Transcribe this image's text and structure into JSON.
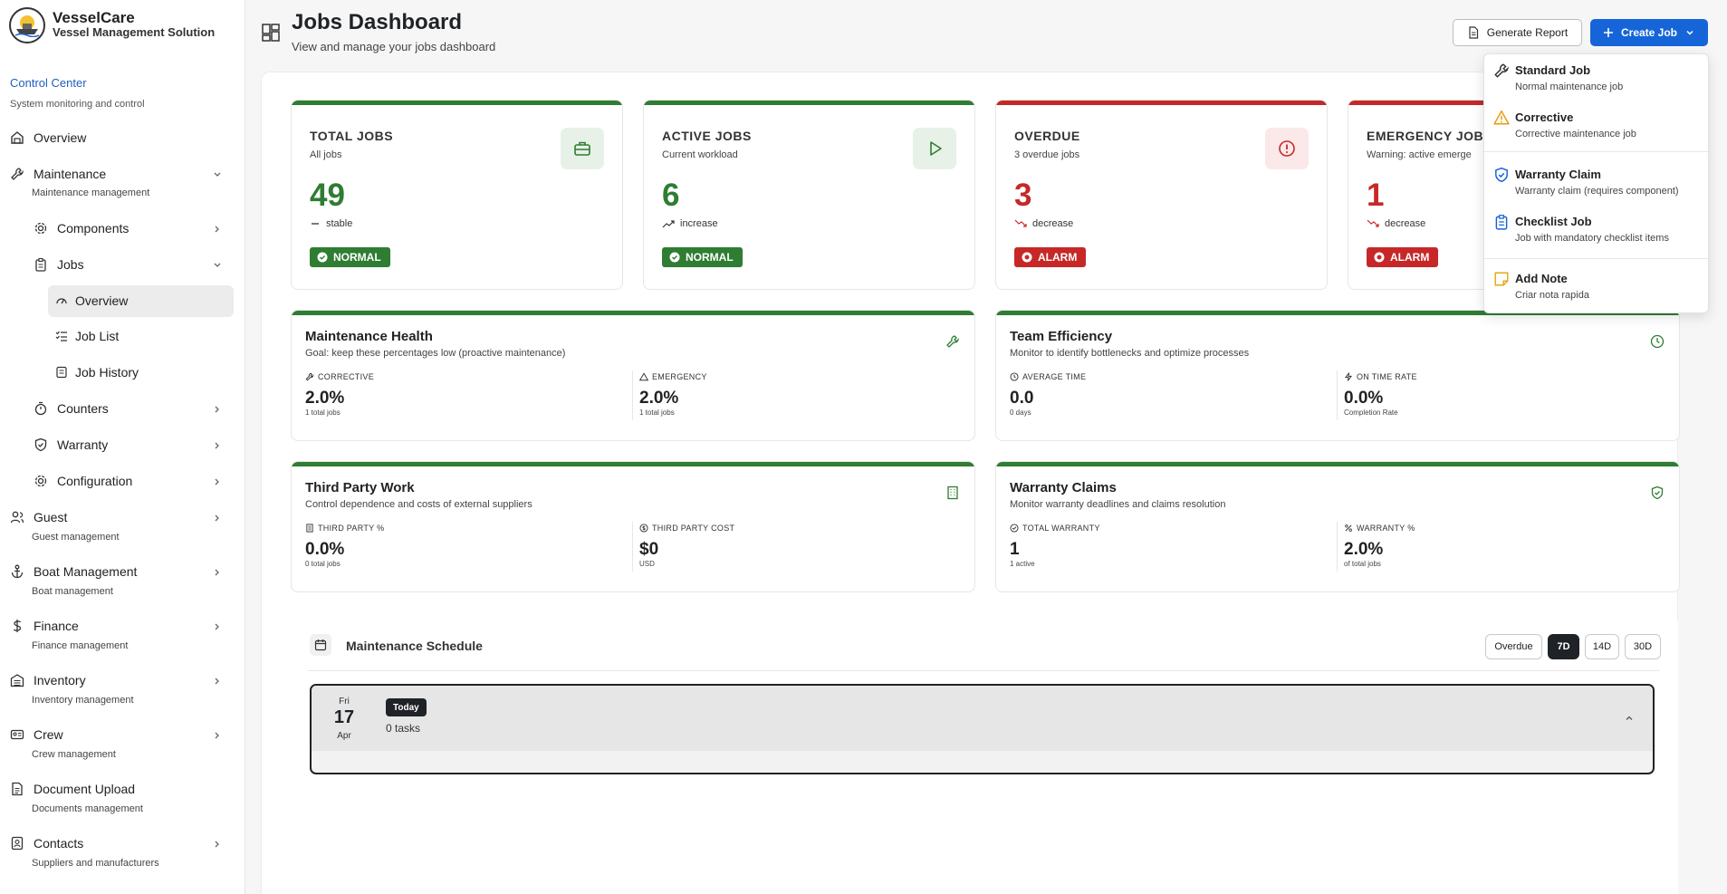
{
  "app": {
    "name": "VesselCare",
    "tagline": "Vessel Management Solution"
  },
  "sidebar": {
    "section_title": "Control Center",
    "section_sub": "System monitoring and control",
    "items": [
      {
        "label": "Overview"
      },
      {
        "label": "Maintenance",
        "sub": "Maintenance management"
      },
      {
        "label": "Components"
      },
      {
        "label": "Jobs"
      },
      {
        "label": "Overview"
      },
      {
        "label": "Job List"
      },
      {
        "label": "Job History"
      },
      {
        "label": "Counters"
      },
      {
        "label": "Warranty"
      },
      {
        "label": "Configuration"
      },
      {
        "label": "Guest",
        "sub": "Guest management"
      },
      {
        "label": "Boat Management",
        "sub": "Boat management"
      },
      {
        "label": "Finance",
        "sub": "Finance management"
      },
      {
        "label": "Inventory",
        "sub": "Inventory management"
      },
      {
        "label": "Crew",
        "sub": "Crew management"
      },
      {
        "label": "Document Upload",
        "sub": "Documents management"
      },
      {
        "label": "Contacts",
        "sub": "Suppliers and manufacturers"
      }
    ]
  },
  "header": {
    "title": "Jobs Dashboard",
    "subtitle": "View and manage your jobs dashboard",
    "report_label": "Generate Report",
    "create_label": "Create Job"
  },
  "stats": [
    {
      "title": "TOTAL JOBS",
      "sub": "All jobs",
      "value": "49",
      "trend": "stable",
      "badge": "NORMAL",
      "color": "#2e7d32"
    },
    {
      "title": "ACTIVE JOBS",
      "sub": "Current workload",
      "value": "6",
      "trend": "increase",
      "badge": "NORMAL",
      "color": "#2e7d32"
    },
    {
      "title": "OVERDUE",
      "sub": "3 overdue jobs",
      "value": "3",
      "trend": "decrease",
      "badge": "ALARM",
      "color": "#c62828"
    },
    {
      "title": "EMERGENCY JOBS",
      "sub": "Warning: active emerge",
      "value": "1",
      "trend": "decrease",
      "badge": "ALARM",
      "color": "#c62828"
    }
  ],
  "cards": {
    "maintenance": {
      "title": "Maintenance Health",
      "sub": "Goal: keep these percentages low (proactive maintenance)",
      "m1": {
        "label": "CORRECTIVE",
        "value": "2.0%",
        "sub": "1 total jobs"
      },
      "m2": {
        "label": "EMERGENCY",
        "value": "2.0%",
        "sub": "1 total jobs"
      }
    },
    "team": {
      "title": "Team Efficiency",
      "sub": "Monitor to identify bottlenecks and optimize processes",
      "m1": {
        "label": "AVERAGE TIME",
        "value": "0.0",
        "sub": "0 days"
      },
      "m2": {
        "label": "ON TIME RATE",
        "value": "0.0%",
        "sub": "Completion Rate"
      }
    },
    "third": {
      "title": "Third Party Work",
      "sub": "Control dependence and costs of external suppliers",
      "m1": {
        "label": "THIRD PARTY %",
        "value": "0.0%",
        "sub": "0 total jobs"
      },
      "m2": {
        "label": "THIRD PARTY COST",
        "value": "$0",
        "sub": "USD"
      }
    },
    "warranty": {
      "title": "Warranty Claims",
      "sub": "Monitor warranty deadlines and claims resolution",
      "m1": {
        "label": "TOTAL WARRANTY",
        "value": "1",
        "sub": "1 active"
      },
      "m2": {
        "label": "WARRANTY %",
        "value": "2.0%",
        "sub": "of total jobs"
      }
    }
  },
  "schedule": {
    "title": "Maintenance Schedule",
    "filters": [
      "Overdue",
      "7D",
      "14D",
      "30D"
    ],
    "selected_filter": "7D",
    "day": {
      "weekday": "Fri",
      "date": "17",
      "month": "Apr",
      "badge": "Today",
      "tasks": "0 tasks"
    }
  },
  "dropdown": {
    "items": [
      {
        "title": "Standard Job",
        "sub": "Normal maintenance job"
      },
      {
        "title": "Corrective",
        "sub": "Corrective maintenance job"
      },
      {
        "title": "Warranty Claim",
        "sub": "Warranty claim (requires component)"
      },
      {
        "title": "Checklist Job",
        "sub": "Job with mandatory checklist items"
      },
      {
        "title": "Add Note",
        "sub": "Criar nota rapida"
      }
    ]
  },
  "colors": {
    "accent": "#1665d8",
    "ok": "#2e7d32",
    "alarm": "#c62828"
  }
}
